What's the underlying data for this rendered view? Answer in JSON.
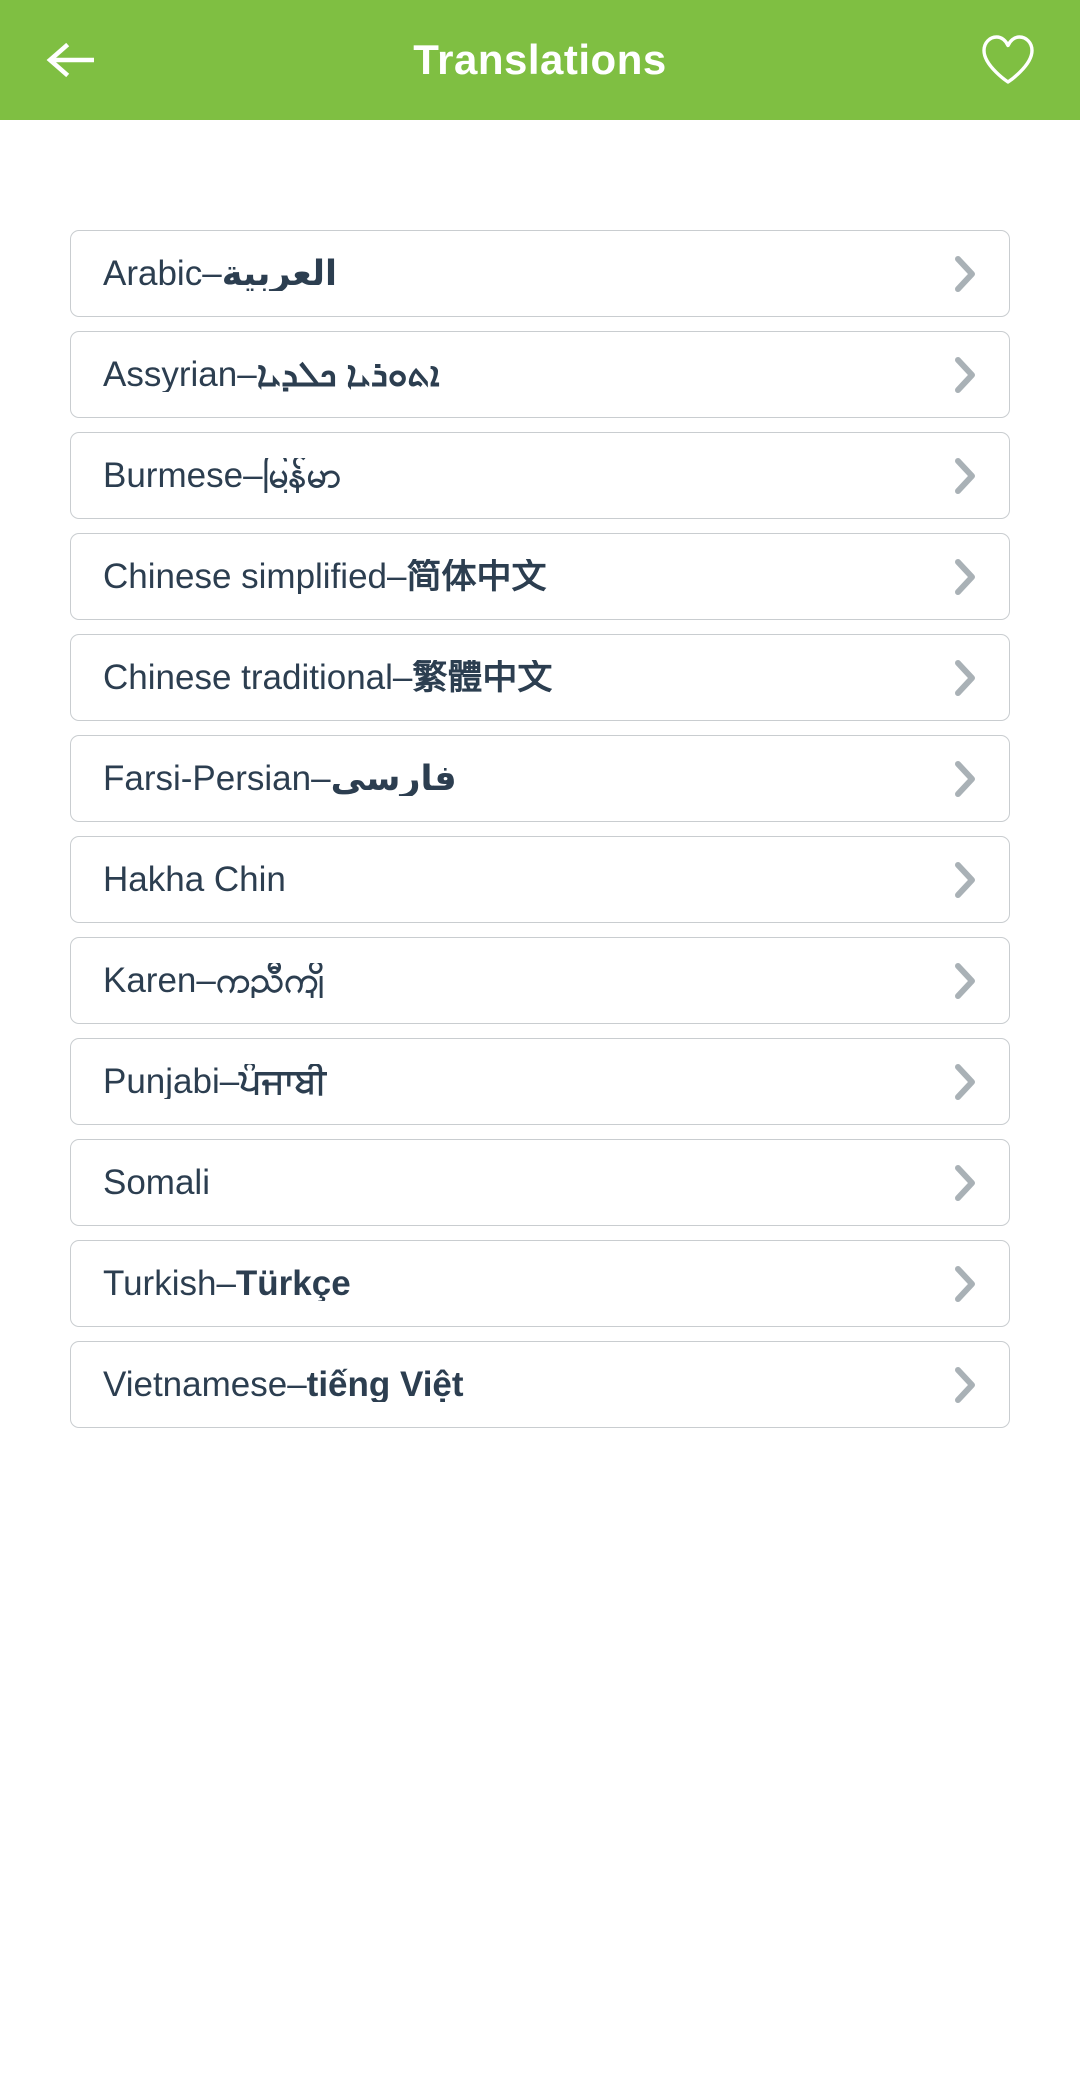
{
  "header": {
    "title": "Translations",
    "back_icon": "arrow-left-icon",
    "favorite_icon": "heart-outline-icon",
    "background_color": "#7FBF42",
    "text_color": "#FFFFFF"
  },
  "theme": {
    "card_border_color": "#C9CDD0",
    "text_color": "#2C3E50",
    "chevron_color": "#A9B1B6",
    "page_background": "#FFFFFF"
  },
  "list": {
    "chevron_icon": "chevron-right-icon",
    "separator": " – ",
    "items": [
      {
        "name": "Arabic",
        "native": "العربية"
      },
      {
        "name": "Assyrian",
        "native": "ܐܬܘܪܝܐ ܟܠܕܝܐ"
      },
      {
        "name": "Burmese",
        "native": "မြန်မာ"
      },
      {
        "name": "Chinese simplified",
        "native": "简体中文"
      },
      {
        "name": "Chinese traditional",
        "native": "繁體中文"
      },
      {
        "name": "Farsi-Persian",
        "native": "فارسی"
      },
      {
        "name": "Hakha Chin",
        "native": ""
      },
      {
        "name": "Karen",
        "native": "ကညီကျိ"
      },
      {
        "name": "Punjabi",
        "native": "ਪੰਜਾਬੀ"
      },
      {
        "name": "Somali",
        "native": ""
      },
      {
        "name": "Turkish",
        "native": "Türkçe"
      },
      {
        "name": "Vietnamese",
        "native": "tiếng Việt"
      }
    ]
  }
}
